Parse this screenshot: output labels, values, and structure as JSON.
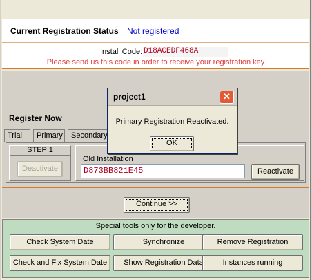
{
  "status": {
    "label": "Current Registration Status",
    "value": "Not registered"
  },
  "install": {
    "label": "Install Code:",
    "code": "D18ACEDF468A",
    "hint": "Please send us this code in order to receive your registration key"
  },
  "register": {
    "heading": "Register Now",
    "tabs": [
      "Trial",
      "Primary",
      "Secondary"
    ],
    "step_label": "STEP 1",
    "deactivate_label": "Deactivate",
    "old_install_label": "Old Installation",
    "old_install_value": "D873BB821E45",
    "reactivate_label": "Reactivate"
  },
  "continue_label": "Continue >>",
  "developer": {
    "title": "Special tools only for the developer.",
    "buttons": [
      "Check System Date",
      "Synchronize",
      "Remove Registration",
      "Check and Fix System Date",
      "Show Registration Data",
      "Instances running"
    ]
  },
  "dialog": {
    "title": "project1",
    "close_glyph": "✕",
    "message": "Primary Registration Reactivated.",
    "ok_label": "OK"
  }
}
